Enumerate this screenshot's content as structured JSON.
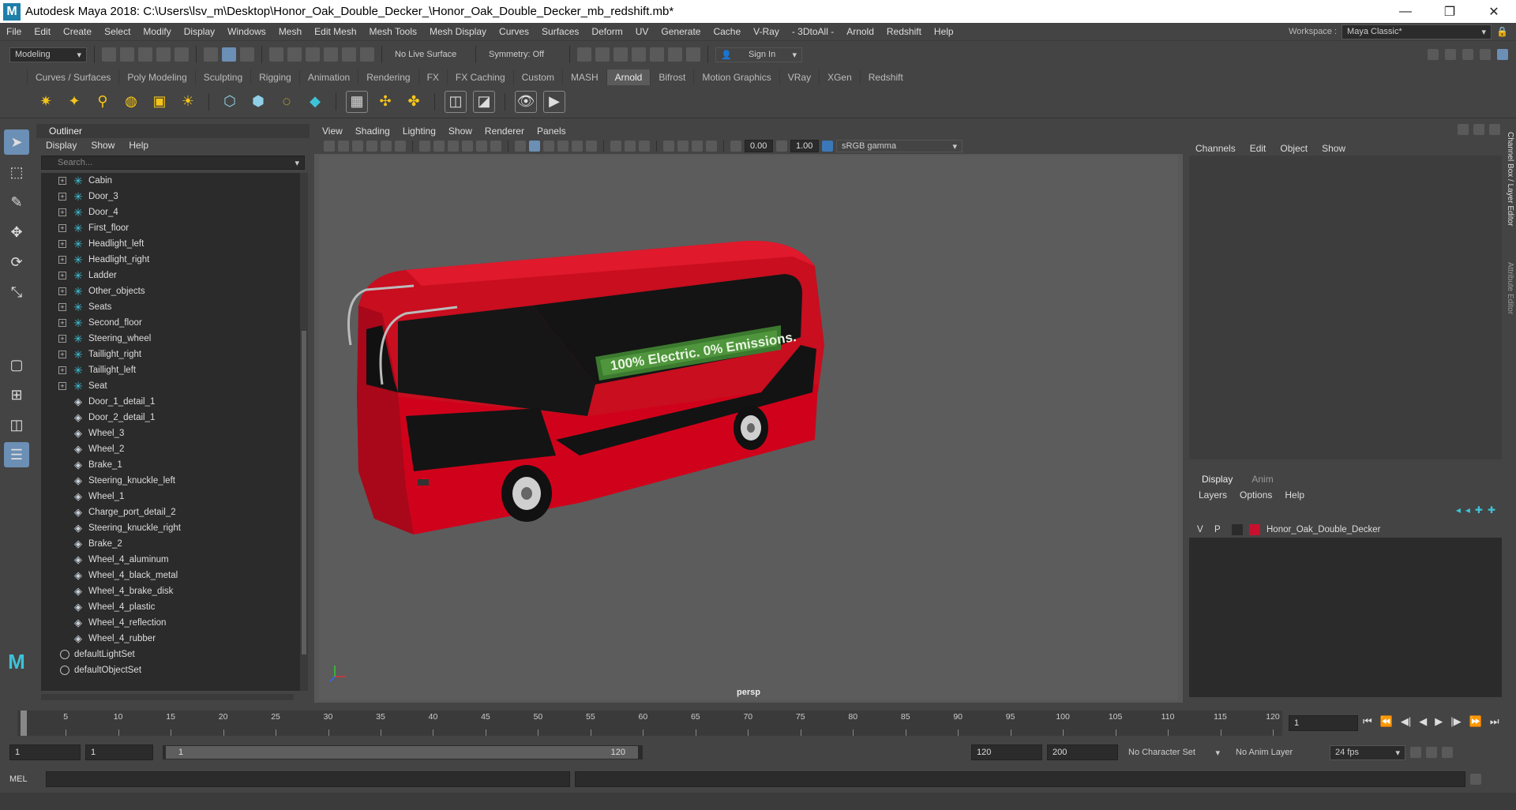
{
  "window": {
    "title": "Autodesk Maya 2018: C:\\Users\\lsv_m\\Desktop\\Honor_Oak_Double_Decker_\\Honor_Oak_Double_Decker_mb_redshift.mb*",
    "logo": "M"
  },
  "menubar": {
    "items": [
      "File",
      "Edit",
      "Create",
      "Select",
      "Modify",
      "Display",
      "Windows",
      "Mesh",
      "Edit Mesh",
      "Mesh Tools",
      "Mesh Display",
      "Curves",
      "Surfaces",
      "Deform",
      "UV",
      "Generate",
      "Cache",
      "V-Ray",
      "- 3DtoAll -",
      "Arnold",
      "Redshift",
      "Help"
    ],
    "workspace_label": "Workspace :",
    "workspace_value": "Maya Classic*"
  },
  "statusline": {
    "mode": "Modeling",
    "live_surface": "No Live Surface",
    "symmetry": "Symmetry: Off",
    "sign_in": "Sign In"
  },
  "shelf": {
    "tabs": [
      "Curves / Surfaces",
      "Poly Modeling",
      "Sculpting",
      "Rigging",
      "Animation",
      "Rendering",
      "FX",
      "FX Caching",
      "Custom",
      "MASH",
      "Arnold",
      "Bifrost",
      "Motion Graphics",
      "VRay",
      "XGen",
      "Redshift"
    ],
    "active_tab": "Arnold"
  },
  "outliner": {
    "title": "Outliner",
    "menu": [
      "Display",
      "Show",
      "Help"
    ],
    "search_placeholder": "Search...",
    "items": [
      {
        "label": "Cabin",
        "kind": "transform"
      },
      {
        "label": "Door_3",
        "kind": "transform"
      },
      {
        "label": "Door_4",
        "kind": "transform"
      },
      {
        "label": "First_floor",
        "kind": "transform"
      },
      {
        "label": "Headlight_left",
        "kind": "transform"
      },
      {
        "label": "Headlight_right",
        "kind": "transform"
      },
      {
        "label": "Ladder",
        "kind": "transform"
      },
      {
        "label": "Other_objects",
        "kind": "transform"
      },
      {
        "label": "Seats",
        "kind": "transform"
      },
      {
        "label": "Second_floor",
        "kind": "transform"
      },
      {
        "label": "Steering_wheel",
        "kind": "transform"
      },
      {
        "label": "Taillight_right",
        "kind": "transform"
      },
      {
        "label": "Taillight_left",
        "kind": "transform"
      },
      {
        "label": "Seat",
        "kind": "transform"
      },
      {
        "label": "Door_1_detail_1",
        "kind": "mesh"
      },
      {
        "label": "Door_2_detail_1",
        "kind": "mesh"
      },
      {
        "label": "Wheel_3",
        "kind": "mesh"
      },
      {
        "label": "Wheel_2",
        "kind": "mesh"
      },
      {
        "label": "Brake_1",
        "kind": "mesh"
      },
      {
        "label": "Steering_knuckle_left",
        "kind": "mesh"
      },
      {
        "label": "Wheel_1",
        "kind": "mesh"
      },
      {
        "label": "Charge_port_detail_2",
        "kind": "mesh"
      },
      {
        "label": "Steering_knuckle_right",
        "kind": "mesh"
      },
      {
        "label": "Brake_2",
        "kind": "mesh"
      },
      {
        "label": "Wheel_4_aluminum",
        "kind": "mesh"
      },
      {
        "label": "Wheel_4_black_metal",
        "kind": "mesh"
      },
      {
        "label": "Wheel_4_brake_disk",
        "kind": "mesh"
      },
      {
        "label": "Wheel_4_plastic",
        "kind": "mesh"
      },
      {
        "label": "Wheel_4_reflection",
        "kind": "mesh"
      },
      {
        "label": "Wheel_4_rubber",
        "kind": "mesh"
      },
      {
        "label": "defaultLightSet",
        "kind": "set"
      },
      {
        "label": "defaultObjectSet",
        "kind": "set"
      }
    ]
  },
  "viewport": {
    "menu": [
      "View",
      "Shading",
      "Lighting",
      "Show",
      "Renderer",
      "Panels"
    ],
    "exposure": "0.00",
    "gamma": "1.00",
    "color_space": "sRGB gamma",
    "camera_label": "persp",
    "bus_banner": "100% Electric. 0% Emissions."
  },
  "channelbox": {
    "menu": [
      "Channels",
      "Edit",
      "Object",
      "Show"
    ],
    "side_tabs": [
      "Channel Box / Layer Editor",
      "Attribute Editor"
    ]
  },
  "layer_editor": {
    "tabs": [
      "Display",
      "Anim"
    ],
    "active_tab": "Display",
    "menu": [
      "Layers",
      "Options",
      "Help"
    ],
    "layers": [
      {
        "v": "V",
        "p": "P",
        "name": "Honor_Oak_Double_Decker",
        "color": "#c8102e"
      }
    ]
  },
  "timeline": {
    "ticks": [
      1,
      5,
      10,
      15,
      20,
      25,
      30,
      35,
      40,
      45,
      50,
      55,
      60,
      65,
      70,
      75,
      80,
      85,
      90,
      95,
      100,
      105,
      110,
      115,
      120
    ],
    "current_frame": "1"
  },
  "range": {
    "start": "1",
    "playback_start": "1",
    "slider_start": "1",
    "slider_end": "120",
    "playback_end": "120",
    "end": "200",
    "character_set": "No Character Set",
    "anim_layer": "No Anim Layer",
    "fps": "24 fps"
  },
  "cmdline": {
    "label": "MEL"
  },
  "colors": {
    "accent": "#6b8fb5",
    "bus_red": "#d0021b",
    "outliner_icon": "#3ec2d8"
  }
}
